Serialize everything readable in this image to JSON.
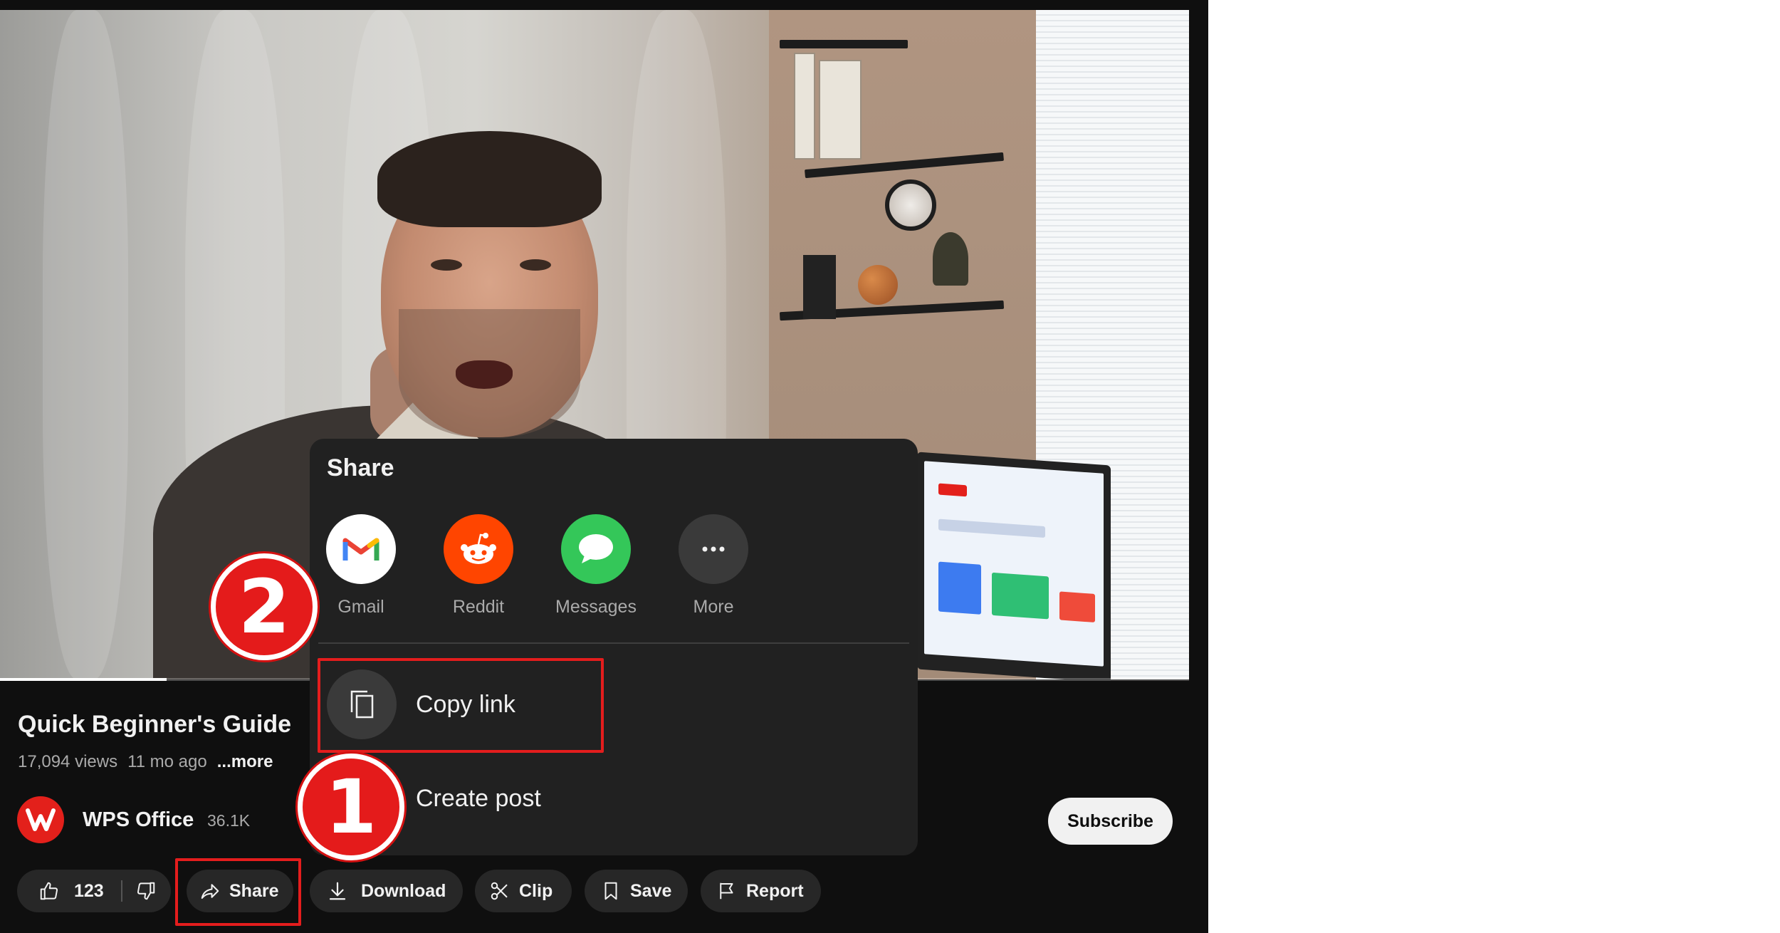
{
  "video": {
    "title": "Quick Beginner's Guide",
    "views": "17,094 views",
    "age": "11 mo ago",
    "more_label": "...more",
    "progress_fraction": 0.14
  },
  "channel": {
    "name": "WPS Office",
    "subscribers": "36.1K",
    "subscribe_label": "Subscribe",
    "logo_color": "#e3201b"
  },
  "actions": {
    "like_count": "123",
    "share_label": "Share",
    "download_label": "Download",
    "clip_label": "Clip",
    "save_label": "Save",
    "report_label": "Report"
  },
  "share_dialog": {
    "title": "Share",
    "options": [
      {
        "label": "Gmail",
        "icon": "gmail-icon",
        "color": "#ffffff"
      },
      {
        "label": "Reddit",
        "icon": "reddit-icon",
        "color": "#ff4500"
      },
      {
        "label": "Messages",
        "icon": "messages-icon",
        "color": "#34c759"
      },
      {
        "label": "More",
        "icon": "more-icon",
        "color": "#3a3a3a"
      }
    ],
    "copy_link_label": "Copy link",
    "create_post_label": "Create post"
  },
  "annotations": {
    "step1": "1",
    "step2": "2",
    "color": "#e41d1d"
  }
}
